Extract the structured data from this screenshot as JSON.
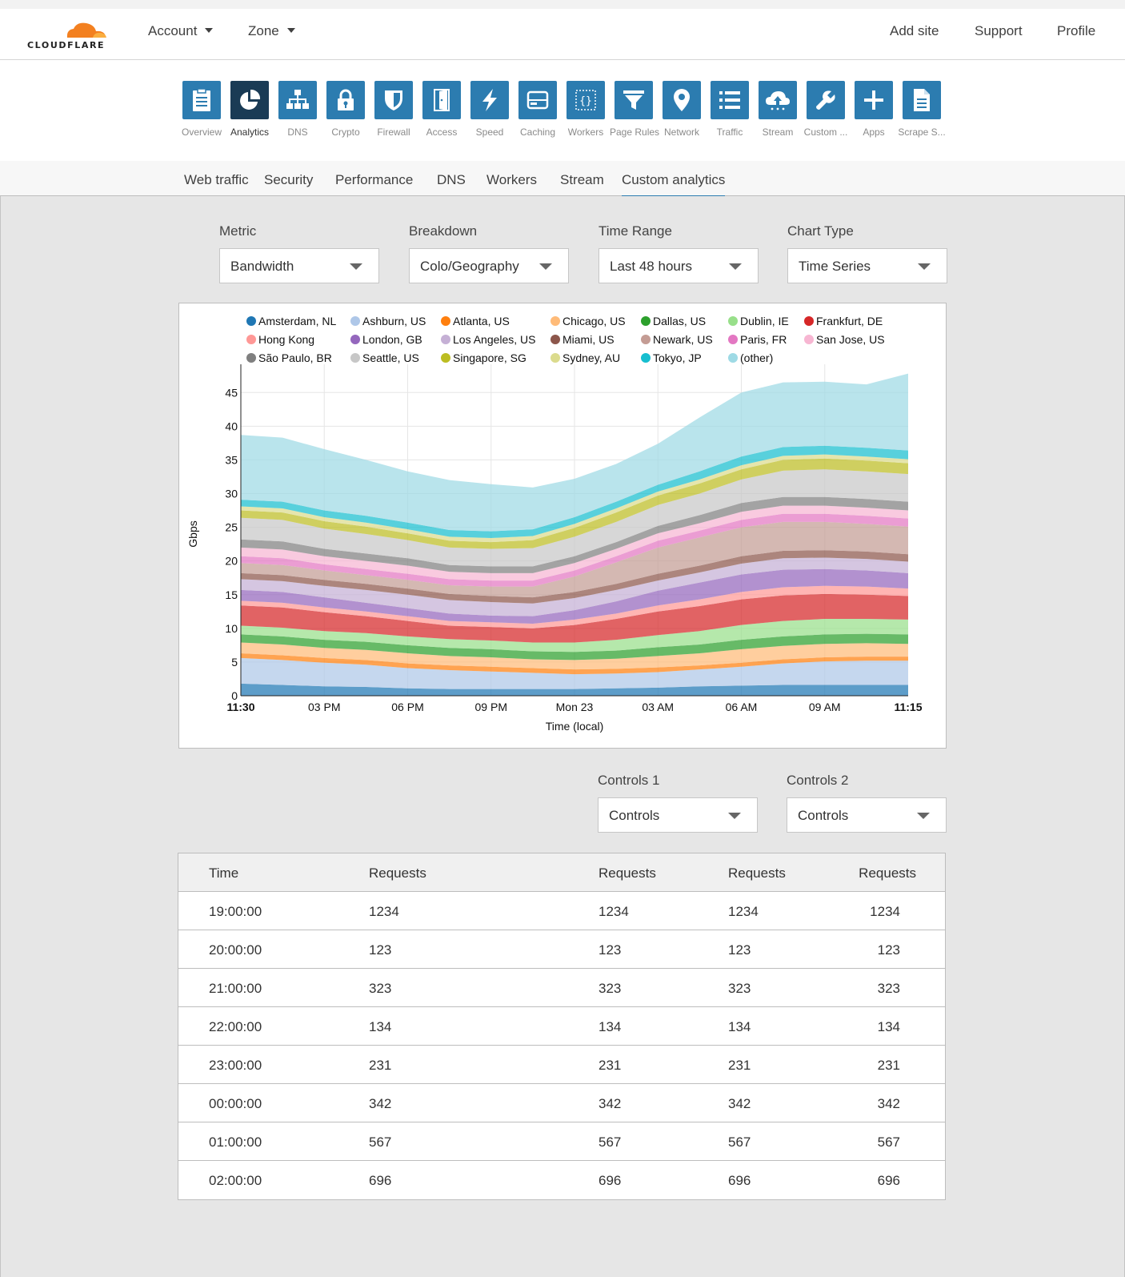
{
  "brand": {
    "name": "CLOUDFLARE",
    "accent": "#f38020"
  },
  "header": {
    "account_label": "Account",
    "zone_label": "Zone",
    "add_site": "Add site",
    "support": "Support",
    "profile": "Profile"
  },
  "apps": [
    {
      "label": "Overview",
      "icon": "overview-icon"
    },
    {
      "label": "Analytics",
      "icon": "analytics-icon",
      "active": true
    },
    {
      "label": "DNS",
      "icon": "dns-icon"
    },
    {
      "label": "Crypto",
      "icon": "lock-icon"
    },
    {
      "label": "Firewall",
      "icon": "shield-icon"
    },
    {
      "label": "Access",
      "icon": "door-icon"
    },
    {
      "label": "Speed",
      "icon": "lightning-icon"
    },
    {
      "label": "Caching",
      "icon": "server-icon"
    },
    {
      "label": "Workers",
      "icon": "code-icon"
    },
    {
      "label": "Page Rules",
      "icon": "filter-icon"
    },
    {
      "label": "Network",
      "icon": "pin-icon"
    },
    {
      "label": "Traffic",
      "icon": "list-icon"
    },
    {
      "label": "Stream",
      "icon": "cloud-upload-icon"
    },
    {
      "label": "Custom ...",
      "icon": "wrench-icon"
    },
    {
      "label": "Apps",
      "icon": "plus-icon"
    },
    {
      "label": "Scrape S...",
      "icon": "document-icon"
    }
  ],
  "tabs": [
    "Web traffic",
    "Security",
    "Performance",
    "DNS",
    "Workers",
    "Stream",
    "Custom analytics"
  ],
  "active_tab": "Custom analytics",
  "filters": {
    "metric": {
      "label": "Metric",
      "value": "Bandwidth"
    },
    "breakdown": {
      "label": "Breakdown",
      "value": "Colo/Geography"
    },
    "time_range": {
      "label": "Time Range",
      "value": "Last 48 hours"
    },
    "chart_type": {
      "label": "Chart Type",
      "value": "Time Series"
    }
  },
  "controls": {
    "c1": {
      "label": "Controls 1",
      "value": "Controls"
    },
    "c2": {
      "label": "Controls 2",
      "value": "Controls"
    }
  },
  "chart_data": {
    "type": "area",
    "stacked": true,
    "xlabel": "Time (local)",
    "ylabel": "Gbps",
    "ylim": [
      0,
      48
    ],
    "yticks": [
      0,
      5,
      10,
      15,
      20,
      25,
      30,
      35,
      40,
      45
    ],
    "xticks": [
      "11:30",
      "03 PM",
      "06 PM",
      "09 PM",
      "Mon 23",
      "03 AM",
      "06 AM",
      "09 AM",
      "11:15"
    ],
    "legend_position": "top",
    "series": [
      {
        "name": "Amsterdam, NL",
        "color": "#1f77b4",
        "values": [
          1.8,
          1.6,
          1.4,
          1.3,
          1.1,
          1.0,
          1.0,
          1.0,
          1.0,
          1.1,
          1.2,
          1.4,
          1.5,
          1.6,
          1.6,
          1.6,
          1.6
        ]
      },
      {
        "name": "Ashburn, US",
        "color": "#aec7e8",
        "values": [
          3.8,
          3.7,
          3.5,
          3.3,
          3.0,
          2.8,
          2.6,
          2.4,
          2.2,
          2.2,
          2.3,
          2.5,
          2.8,
          3.2,
          3.5,
          3.6,
          3.6
        ]
      },
      {
        "name": "Atlanta, US",
        "color": "#ff7f0e",
        "values": [
          0.7,
          0.7,
          0.7,
          0.7,
          0.7,
          0.7,
          0.7,
          0.7,
          0.7,
          0.7,
          0.7,
          0.6,
          0.6,
          0.6,
          0.6,
          0.6,
          0.6
        ]
      },
      {
        "name": "Chicago, US",
        "color": "#ffbb78",
        "values": [
          1.6,
          1.6,
          1.5,
          1.5,
          1.5,
          1.4,
          1.4,
          1.3,
          1.4,
          1.5,
          1.7,
          1.8,
          2.0,
          2.0,
          2.0,
          2.0,
          1.9
        ]
      },
      {
        "name": "Dallas, US",
        "color": "#2ca02c",
        "values": [
          1.2,
          1.2,
          1.2,
          1.2,
          1.2,
          1.2,
          1.2,
          1.2,
          1.2,
          1.2,
          1.3,
          1.3,
          1.4,
          1.4,
          1.4,
          1.4,
          1.4
        ]
      },
      {
        "name": "Dublin, IE",
        "color": "#98df8a",
        "values": [
          1.3,
          1.3,
          1.3,
          1.3,
          1.3,
          1.3,
          1.3,
          1.3,
          1.4,
          1.6,
          1.8,
          2.0,
          2.2,
          2.3,
          2.3,
          2.2,
          2.2
        ]
      },
      {
        "name": "Frankfurt, DE",
        "color": "#d62728",
        "values": [
          3.0,
          3.0,
          2.8,
          2.5,
          2.3,
          2.0,
          2.0,
          2.1,
          2.6,
          3.1,
          3.5,
          3.7,
          3.8,
          3.8,
          3.7,
          3.6,
          3.5
        ]
      },
      {
        "name": "Hong Kong",
        "color": "#ff9896",
        "values": [
          0.7,
          0.7,
          0.7,
          0.7,
          0.7,
          0.7,
          0.7,
          0.7,
          0.8,
          0.8,
          0.9,
          1.0,
          1.1,
          1.2,
          1.2,
          1.2,
          1.1
        ]
      },
      {
        "name": "London, GB",
        "color": "#9467bd",
        "values": [
          1.6,
          1.6,
          1.5,
          1.3,
          1.2,
          1.1,
          1.0,
          1.1,
          1.4,
          1.8,
          2.2,
          2.5,
          2.6,
          2.6,
          2.5,
          2.4,
          2.3
        ]
      },
      {
        "name": "Los Angeles, US",
        "color": "#c5b0d5",
        "values": [
          1.6,
          1.6,
          1.7,
          1.9,
          2.0,
          2.0,
          2.0,
          1.9,
          1.8,
          1.7,
          1.5,
          1.5,
          1.6,
          1.7,
          1.7,
          1.7,
          1.7
        ]
      },
      {
        "name": "Miami, US",
        "color": "#8c564b",
        "values": [
          0.9,
          0.9,
          0.9,
          0.9,
          0.9,
          0.9,
          0.9,
          0.9,
          0.9,
          0.9,
          1.0,
          1.0,
          1.1,
          1.1,
          1.1,
          1.1,
          1.1
        ]
      },
      {
        "name": "Newark, US",
        "color": "#c49c94",
        "values": [
          1.5,
          1.5,
          1.4,
          1.3,
          1.3,
          1.3,
          1.4,
          1.6,
          2.3,
          3.2,
          3.9,
          4.2,
          4.3,
          4.3,
          4.2,
          4.1,
          4.1
        ]
      },
      {
        "name": "Paris, FR",
        "color": "#e377c2",
        "values": [
          1.0,
          1.0,
          0.9,
          0.9,
          0.9,
          0.9,
          0.9,
          0.9,
          0.9,
          0.9,
          1.0,
          1.0,
          1.1,
          1.2,
          1.2,
          1.2,
          1.2
        ]
      },
      {
        "name": "San Jose, US",
        "color": "#f7b6d2",
        "values": [
          1.3,
          1.3,
          1.2,
          1.2,
          1.2,
          1.1,
          1.1,
          1.1,
          1.1,
          1.1,
          1.1,
          1.1,
          1.2,
          1.2,
          1.2,
          1.2,
          1.2
        ]
      },
      {
        "name": "São Paulo, BR",
        "color": "#7f7f7f",
        "values": [
          1.2,
          1.2,
          1.1,
          1.1,
          1.1,
          1.0,
          1.0,
          1.0,
          1.0,
          1.0,
          1.1,
          1.2,
          1.3,
          1.3,
          1.3,
          1.3,
          1.3
        ]
      },
      {
        "name": "Seattle, US",
        "color": "#c7c7c7",
        "values": [
          3.2,
          3.2,
          3.0,
          2.9,
          2.7,
          2.6,
          2.6,
          2.7,
          2.9,
          3.0,
          3.1,
          3.2,
          3.5,
          3.9,
          4.1,
          4.1,
          4.1
        ]
      },
      {
        "name": "Singapore, SG",
        "color": "#bcbd22",
        "values": [
          1.1,
          1.1,
          1.1,
          1.1,
          1.0,
          1.0,
          1.0,
          1.2,
          1.3,
          1.4,
          1.4,
          1.5,
          1.5,
          1.6,
          1.6,
          1.6,
          1.6
        ]
      },
      {
        "name": "Sydney, AU",
        "color": "#dbdb8d",
        "values": [
          0.6,
          0.6,
          0.6,
          0.6,
          0.6,
          0.6,
          0.6,
          0.6,
          0.6,
          0.6,
          0.6,
          0.6,
          0.6,
          0.6,
          0.6,
          0.6,
          0.6
        ]
      },
      {
        "name": "Tokyo, JP",
        "color": "#17becf",
        "values": [
          1.0,
          1.0,
          1.0,
          1.0,
          1.0,
          1.0,
          1.0,
          1.0,
          1.0,
          1.0,
          1.0,
          1.2,
          1.3,
          1.3,
          1.3,
          1.3,
          1.3
        ]
      },
      {
        "name": "(other)",
        "color": "#9edae5",
        "values": [
          9.6,
          9.5,
          9.1,
          8.3,
          7.6,
          7.4,
          7.0,
          6.2,
          5.7,
          5.6,
          6.1,
          8.0,
          9.5,
          9.6,
          9.5,
          9.4,
          11.4
        ]
      }
    ]
  },
  "table": {
    "headers": [
      "Time",
      "Requests",
      "Requests",
      "Requests",
      "Requests"
    ],
    "rows": [
      [
        "19:00:00",
        "1234",
        "1234",
        "1234",
        "1234"
      ],
      [
        "20:00:00",
        "123",
        "123",
        "123",
        "123"
      ],
      [
        "21:00:00",
        "323",
        "323",
        "323",
        "323"
      ],
      [
        "22:00:00",
        "134",
        "134",
        "134",
        "134"
      ],
      [
        "23:00:00",
        "231",
        "231",
        "231",
        "231"
      ],
      [
        "00:00:00",
        "342",
        "342",
        "342",
        "342"
      ],
      [
        "01:00:00",
        "567",
        "567",
        "567",
        "567"
      ],
      [
        "02:00:00",
        "696",
        "696",
        "696",
        "696"
      ]
    ]
  }
}
